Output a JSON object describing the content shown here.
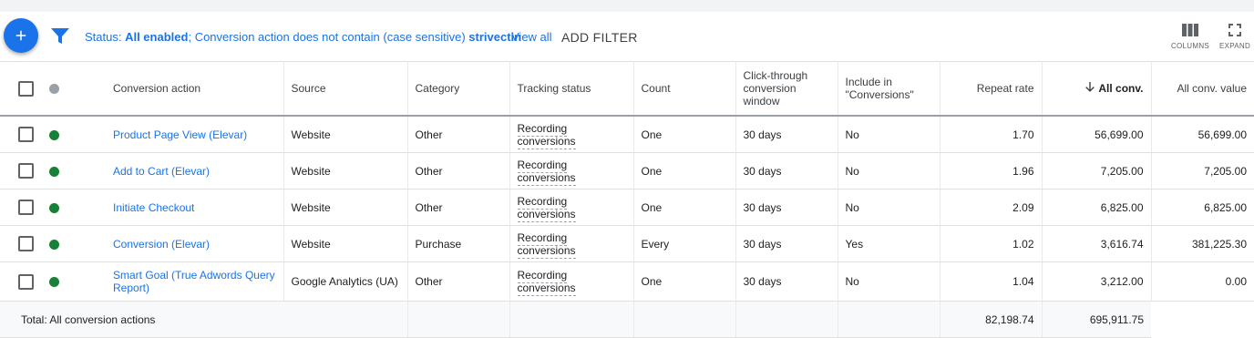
{
  "toolbar": {
    "filter_status_prefix": "Status: ",
    "filter_status_value": "All enabled",
    "filter_separator": ";",
    "filter_conversion_prefix": "Conversion action does not contain (case sensitive) ",
    "filter_conversion_value": "strivectin",
    "view_all": "View all",
    "add_filter": "ADD FILTER",
    "columns_label": "COLUMNS",
    "expand_label": "EXPAND"
  },
  "table": {
    "headers": {
      "conversion_action": "Conversion action",
      "source": "Source",
      "category": "Category",
      "tracking_status": "Tracking status",
      "count": "Count",
      "click_through_window": "Click-through conversion window",
      "include_in_conversions": "Include in \"Conversions\"",
      "repeat_rate": "Repeat rate",
      "all_conv": "All conv.",
      "all_conv_value": "All conv. value"
    },
    "rows": [
      {
        "name": "Product Page View (Elevar)",
        "source": "Website",
        "category": "Other",
        "tracking": "Recording conversions",
        "count": "One",
        "window": "30 days",
        "include": "No",
        "repeat": "1.70",
        "all_conv": "56,699.00",
        "all_conv_value": "56,699.00"
      },
      {
        "name": "Add to Cart (Elevar)",
        "source": "Website",
        "category": "Other",
        "tracking": "Recording conversions",
        "count": "One",
        "window": "30 days",
        "include": "No",
        "repeat": "1.96",
        "all_conv": "7,205.00",
        "all_conv_value": "7,205.00"
      },
      {
        "name": "Initiate Checkout",
        "source": "Website",
        "category": "Other",
        "tracking": "Recording conversions",
        "count": "One",
        "window": "30 days",
        "include": "No",
        "repeat": "2.09",
        "all_conv": "6,825.00",
        "all_conv_value": "6,825.00"
      },
      {
        "name": "Conversion (Elevar)",
        "source": "Website",
        "category": "Purchase",
        "tracking": "Recording conversions",
        "count": "Every",
        "window": "30 days",
        "include": "Yes",
        "repeat": "1.02",
        "all_conv": "3,616.74",
        "all_conv_value": "381,225.30"
      },
      {
        "name": "Smart Goal (True Adwords Query Report)",
        "source": "Google Analytics (UA)",
        "category": "Other",
        "tracking": "Recording conversions",
        "count": "One",
        "window": "30 days",
        "include": "No",
        "repeat": "1.04",
        "all_conv": "3,212.00",
        "all_conv_value": "0.00"
      }
    ],
    "total": {
      "label": "Total: All conversion actions",
      "all_conv": "82,198.74",
      "all_conv_value": "695,911.75"
    }
  },
  "colors": {
    "accent": "#1a73e8",
    "status_enabled": "#188038",
    "status_header": "#9aa0a6"
  },
  "icons": {
    "fab": "plus-icon",
    "filter": "filter-icon",
    "columns": "columns-icon",
    "expand": "expand-icon",
    "sort": "arrow-down-icon"
  }
}
